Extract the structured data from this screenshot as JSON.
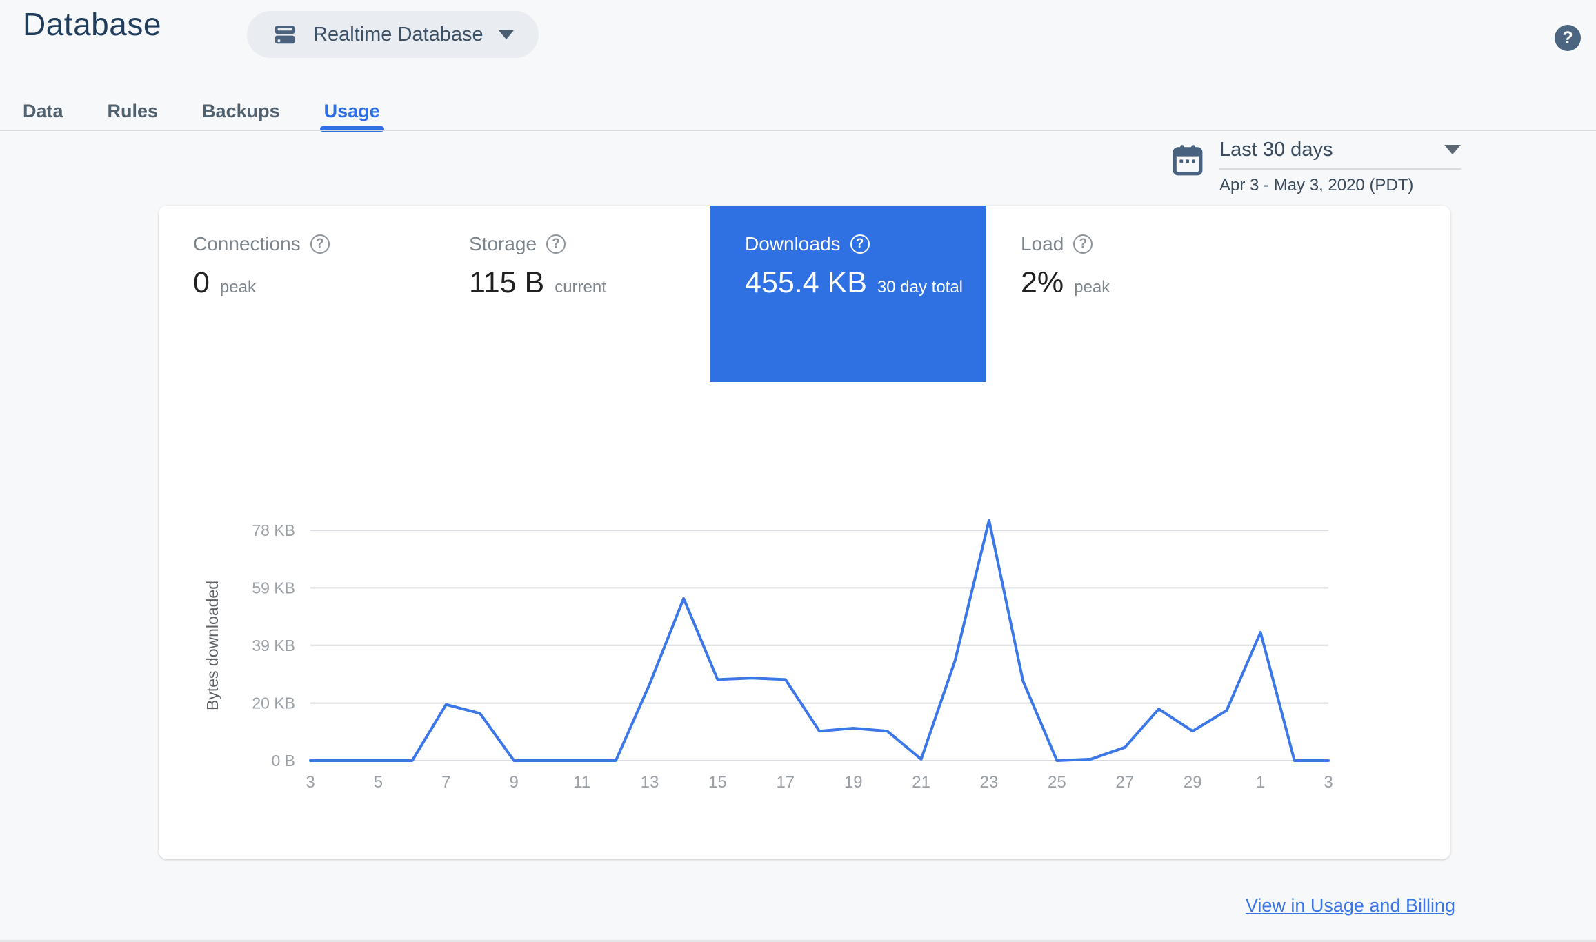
{
  "header": {
    "title": "Database",
    "selector_label": "Realtime Database"
  },
  "icons": {
    "help_glyph": "?"
  },
  "tabs": [
    {
      "label": "Data",
      "active": false
    },
    {
      "label": "Rules",
      "active": false
    },
    {
      "label": "Backups",
      "active": false
    },
    {
      "label": "Usage",
      "active": true
    }
  ],
  "date_range": {
    "preset": "Last 30 days",
    "range": "Apr 3 - May 3, 2020 (PDT)"
  },
  "metrics": [
    {
      "label": "Connections",
      "value": "0",
      "unit": "peak",
      "selected": false
    },
    {
      "label": "Storage",
      "value": "115 B",
      "unit": "current",
      "selected": false
    },
    {
      "label": "Downloads",
      "value": "455.4 KB",
      "unit": "30 day total",
      "selected": true
    },
    {
      "label": "Load",
      "value": "2%",
      "unit": "peak",
      "selected": false
    }
  ],
  "footer": {
    "link_label": "View in Usage and Billing"
  },
  "colors": {
    "accent_blue": "#2f71e3",
    "line_blue": "#3b77e7",
    "active_tab_blue": "#2e6fe3",
    "title_navy": "#203d5c",
    "slate_icon": "#47617e",
    "grid_gray": "#dadce0",
    "tick_gray": "#9aa0a6"
  },
  "chart_data": {
    "type": "line",
    "title": "Bytes downloaded per day (Downloads metric)",
    "ylabel": "Bytes downloaded",
    "x_range": "Apr 3 - May 3, 2020 (PDT)",
    "legend": "none",
    "grid": "horizontal-only",
    "line_color": "#3b77e7",
    "y_axis_max_kb": 78.1,
    "y_ticks": [
      {
        "label": "0 B",
        "kb": 0
      },
      {
        "label": "20 KB",
        "kb": 19.5
      },
      {
        "label": "39 KB",
        "kb": 39.1
      },
      {
        "label": "59 KB",
        "kb": 58.6
      },
      {
        "label": "78 KB",
        "kb": 78.1
      }
    ],
    "x_tick_labels": [
      "3",
      "",
      "5",
      "",
      "7",
      "",
      "9",
      "",
      "11",
      "",
      "13",
      "",
      "15",
      "",
      "17",
      "",
      "19",
      "",
      "21",
      "",
      "23",
      "",
      "25",
      "",
      "27",
      "",
      "29",
      "",
      "1",
      "",
      "3"
    ],
    "values_kb": [
      0,
      0,
      0,
      0,
      19,
      16,
      0,
      0,
      0,
      0,
      26,
      55,
      27.5,
      28,
      27.5,
      10,
      11,
      10,
      0.5,
      34,
      81.5,
      27,
      0,
      0.5,
      4.5,
      17.5,
      10,
      17,
      43.5,
      0,
      0
    ]
  }
}
